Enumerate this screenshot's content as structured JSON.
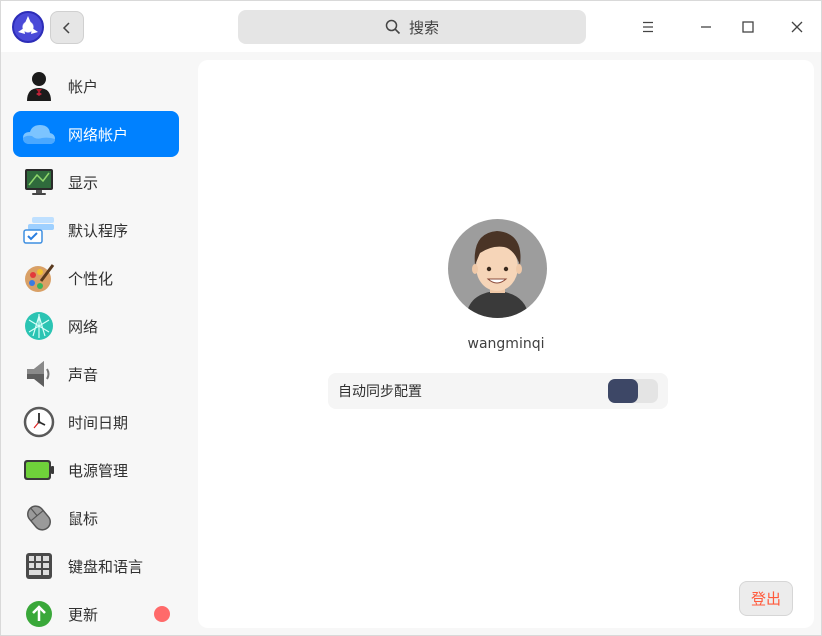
{
  "titlebar": {
    "search_placeholder": "搜索"
  },
  "sidebar": {
    "items": [
      {
        "label": "帐户",
        "icon": "account-icon"
      },
      {
        "label": "网络帐户",
        "icon": "cloud-icon",
        "active": true
      },
      {
        "label": "显示",
        "icon": "display-icon"
      },
      {
        "label": "默认程序",
        "icon": "default-apps-icon"
      },
      {
        "label": "个性化",
        "icon": "palette-icon"
      },
      {
        "label": "网络",
        "icon": "network-icon"
      },
      {
        "label": "声音",
        "icon": "speaker-icon"
      },
      {
        "label": "时间日期",
        "icon": "clock-icon"
      },
      {
        "label": "电源管理",
        "icon": "battery-icon"
      },
      {
        "label": "鼠标",
        "icon": "mouse-icon"
      },
      {
        "label": "键盘和语言",
        "icon": "keyboard-icon"
      },
      {
        "label": "更新",
        "icon": "update-icon",
        "badge": true
      }
    ]
  },
  "main": {
    "username": "wangminqi",
    "sync_label": "自动同步配置",
    "sync_enabled": true,
    "logout_label": "登出"
  },
  "colors": {
    "accent": "#0081ff",
    "toggle_on": "#3d4766",
    "logout_text": "#ff5a3c",
    "badge": "#ff6a6a"
  }
}
